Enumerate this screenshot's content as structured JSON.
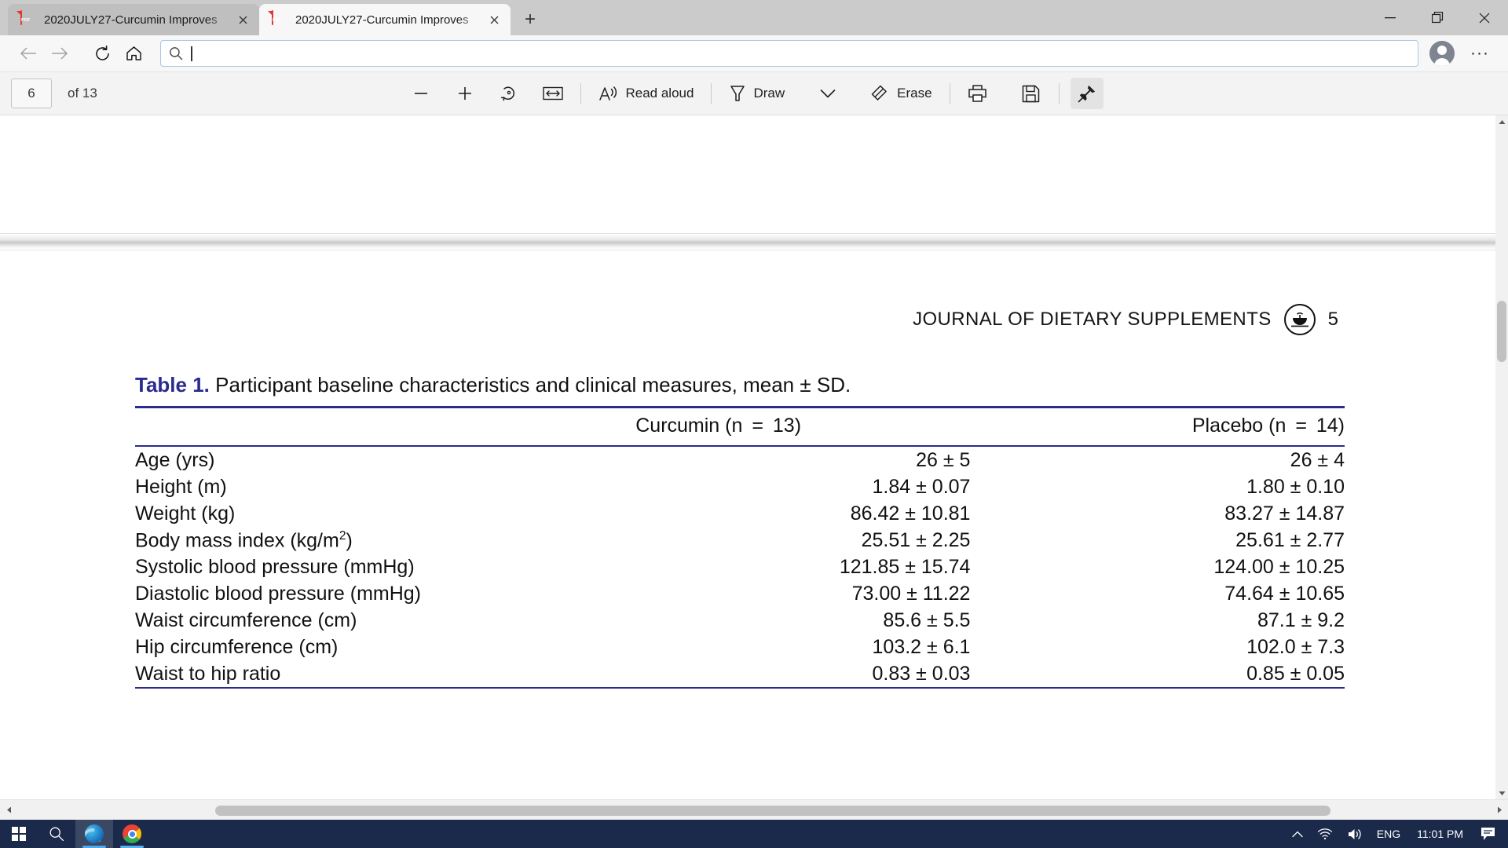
{
  "browser": {
    "tabs": [
      {
        "title": "2020JULY27-Curcumin Improves",
        "icon": "pdf-file-icon",
        "active": false
      },
      {
        "title": "2020JULY27-Curcumin Improves",
        "icon": "pdf-file-icon",
        "active": true
      }
    ],
    "new_tab_label": "+",
    "window_controls": {
      "minimize": "—",
      "maximize": "restore-icon",
      "close": "✕"
    },
    "nav": {
      "back": "back-arrow-icon",
      "forward": "forward-arrow-icon",
      "refresh": "refresh-icon",
      "home": "home-icon"
    },
    "omnibox": {
      "value": "",
      "placeholder": ""
    },
    "profile_label": "profile-avatar",
    "more_label": "···"
  },
  "pdf_toolbar": {
    "page_current": "6",
    "page_total": "of 13",
    "zoom_out_label": "−",
    "zoom_in_label": "+",
    "rotate_label": "rotate-icon",
    "fit_label": "fit-to-width-icon",
    "read_aloud_label": "Read aloud",
    "draw_label": "Draw",
    "draw_chevron_label": "chevron-down-icon",
    "erase_label": "Erase",
    "print_label": "print-icon",
    "save_label": "save-icon",
    "pin_label": "pin-icon"
  },
  "document": {
    "running_head": "JOURNAL OF DIETARY SUPPLEMENTS",
    "logo": "journal-emblem",
    "page_number": "5",
    "table": {
      "caption_label": "Table 1.",
      "caption_text": "Participant baseline characteristics and clinical measures, mean ± SD.",
      "columns": [
        "",
        "Curcumin (n  =  13)",
        "Placebo (n  =  14)"
      ],
      "rows": [
        {
          "measure": "Age (yrs)",
          "measure_sup": "",
          "curcumin": "26 ± 5",
          "placebo": "26 ± 4"
        },
        {
          "measure": "Height (m)",
          "measure_sup": "",
          "curcumin": "1.84 ± 0.07",
          "placebo": "1.80 ± 0.10"
        },
        {
          "measure": "Weight (kg)",
          "measure_sup": "",
          "curcumin": "86.42 ± 10.81",
          "placebo": "83.27 ± 14.87"
        },
        {
          "measure": "Body mass index (kg/m",
          "measure_sup": "2",
          "measure_tail": ")",
          "curcumin": "25.51 ± 2.25",
          "placebo": "25.61 ± 2.77"
        },
        {
          "measure": "Systolic blood pressure (mmHg)",
          "measure_sup": "",
          "curcumin": "121.85 ± 15.74",
          "placebo": "124.00 ± 10.25"
        },
        {
          "measure": "Diastolic blood pressure (mmHg)",
          "measure_sup": "",
          "curcumin": "73.00 ± 11.22",
          "placebo": "74.64 ± 10.65"
        },
        {
          "measure": "Waist circumference (cm)",
          "measure_sup": "",
          "curcumin": "85.6 ± 5.5",
          "placebo": "87.1 ± 9.2"
        },
        {
          "measure": "Hip circumference (cm)",
          "measure_sup": "",
          "curcumin": "103.2 ± 6.1",
          "placebo": "102.0 ± 7.3"
        },
        {
          "measure": "Waist to hip ratio",
          "measure_sup": "",
          "curcumin": "0.83 ± 0.03",
          "placebo": "0.85 ± 0.05"
        }
      ]
    }
  },
  "taskbar": {
    "start_label": "windows-start-icon",
    "search_label": "search-icon",
    "apps": [
      {
        "name": "edge-taskbar-icon",
        "active": true
      },
      {
        "name": "chrome-taskbar-icon",
        "active": false
      }
    ],
    "tray": {
      "overflow": "show-hidden-icons-chevron",
      "network": "wifi-icon",
      "volume": "volume-icon",
      "language": "ENG",
      "time": "11:01 PM",
      "notifications": "notification-center-icon"
    }
  },
  "colors": {
    "accent_blue": "#2b2b8f",
    "taskbar": "#1b2a4a",
    "tab_active": "#f7f7f7",
    "omnibox_border": "#a8c7e8"
  }
}
